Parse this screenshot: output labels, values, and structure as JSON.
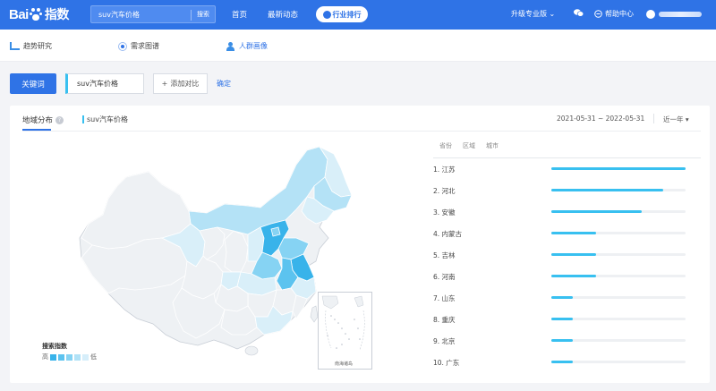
{
  "brand": {
    "logo_text": "Bai",
    "logo_zh": "指数"
  },
  "search": {
    "query": "suv汽车价格",
    "button": "搜索"
  },
  "nav": {
    "home": "首页",
    "news": "最新动态",
    "ranking": "行业排行"
  },
  "header_right": {
    "upgrade": "升级专业版",
    "help": "帮助中心"
  },
  "subnav": {
    "items": [
      {
        "label": "趋势研究",
        "icon": "bar-chart-icon"
      },
      {
        "label": "需求图谱",
        "icon": "radio-icon"
      },
      {
        "label": "人群画像",
        "icon": "people-icon"
      }
    ]
  },
  "keyword_bar": {
    "keyword_button": "关键词",
    "keyword_value": "suv汽车价格",
    "add_compare": "添加对比",
    "confirm": "确定"
  },
  "panel": {
    "tab_geo": "地域分布",
    "tab_keyword": "suv汽车价格",
    "date_range": "2021-05-31 ~ 2022-05-31",
    "period": "近一年"
  },
  "map": {
    "legend_title": "搜索指数",
    "legend_high": "高",
    "legend_low": "低",
    "legend_colors": [
      "#38b3ea",
      "#5cc3ef",
      "#86d3f3",
      "#b1e2f7",
      "#d6eefa"
    ],
    "inset_label": "南海诸岛"
  },
  "ranking": {
    "headers": [
      "省份",
      "区域",
      "城市"
    ],
    "rows": [
      {
        "name": "1.  江苏",
        "value": 1.0
      },
      {
        "name": "2.  河北",
        "value": 0.83
      },
      {
        "name": "3.  安徽",
        "value": 0.67
      },
      {
        "name": "4.  内蒙古",
        "value": 0.33
      },
      {
        "name": "5.  吉林",
        "value": 0.33
      },
      {
        "name": "6.  河南",
        "value": 0.33
      },
      {
        "name": "7.  山东",
        "value": 0.16
      },
      {
        "name": "8.  重庆",
        "value": 0.16
      },
      {
        "name": "9.  北京",
        "value": 0.16
      },
      {
        "name": "10. 广东",
        "value": 0.16
      }
    ]
  }
}
